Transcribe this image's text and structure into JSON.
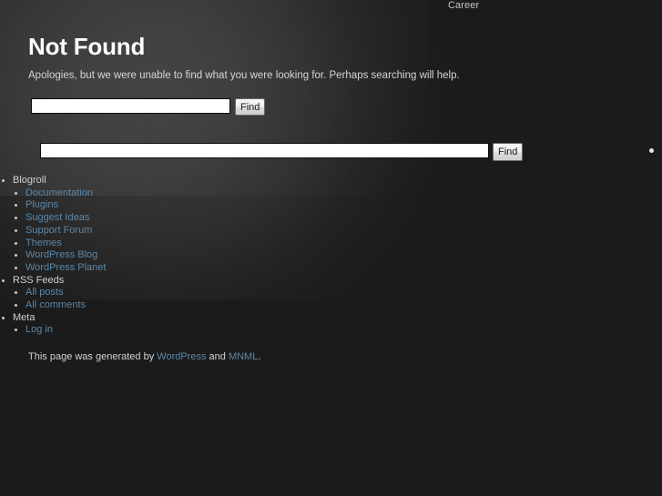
{
  "topnav": {
    "items": [
      {
        "label": "Career"
      }
    ]
  },
  "main": {
    "title": "Not Found",
    "message": "Apologies, but we were unable to find what you were looking for. Perhaps searching will help."
  },
  "search_primary": {
    "value": "",
    "placeholder": "",
    "button_label": "Find"
  },
  "search_secondary": {
    "value": "",
    "placeholder": "",
    "button_label": "Find"
  },
  "linkbar": {
    "groups": [
      {
        "label": "Blogroll",
        "items": [
          {
            "label": "Documentation"
          },
          {
            "label": "Plugins"
          },
          {
            "label": "Suggest Ideas"
          },
          {
            "label": "Support Forum"
          },
          {
            "label": "Themes"
          },
          {
            "label": "WordPress Blog"
          },
          {
            "label": "WordPress Planet"
          }
        ]
      },
      {
        "label": "RSS Feeds",
        "items": [
          {
            "label": "All posts"
          },
          {
            "label": "All comments"
          }
        ]
      },
      {
        "label": "Meta",
        "items": [
          {
            "label": "Log in"
          }
        ]
      }
    ]
  },
  "footer": {
    "prefix": "This page was generated by ",
    "link1": "WordPress",
    "middle": " and ",
    "link2": "MNML",
    "suffix": "."
  },
  "colors": {
    "background": "#1b1b1b",
    "link": "#5b87a8",
    "text": "#d6d6d6",
    "heading": "#ffffff"
  }
}
